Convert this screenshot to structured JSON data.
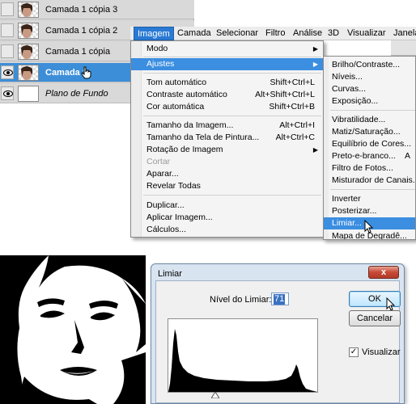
{
  "layers": [
    {
      "name": "Camada 1 cópia 3",
      "visible": false,
      "selected": false
    },
    {
      "name": "Camada 1 cópia 2",
      "visible": false,
      "selected": false
    },
    {
      "name": "Camada 1 cópia",
      "visible": false,
      "selected": false
    },
    {
      "name": "Camada 1",
      "visible": true,
      "selected": true
    },
    {
      "name": "Plano de Fundo",
      "visible": true,
      "selected": false
    }
  ],
  "menubar": [
    "Imagem",
    "Camada",
    "Selecionar",
    "Filtro",
    "Análise",
    "3D",
    "Visualizar",
    "Janela"
  ],
  "menu": [
    {
      "label": "Modo",
      "shortcut": "",
      "submenu": true
    },
    {
      "label": "Ajustes",
      "shortcut": "",
      "submenu": true,
      "highlighted": true
    },
    {
      "label": "Tom automático",
      "shortcut": "Shift+Ctrl+L"
    },
    {
      "label": "Contraste automático",
      "shortcut": "Alt+Shift+Ctrl+L"
    },
    {
      "label": "Cor automática",
      "shortcut": "Shift+Ctrl+B"
    },
    {
      "label": "Tamanho da Imagem...",
      "shortcut": "Alt+Ctrl+I"
    },
    {
      "label": "Tamanho da Tela de Pintura...",
      "shortcut": "Alt+Ctrl+C"
    },
    {
      "label": "Rotação de Imagem",
      "shortcut": "",
      "submenu": true
    },
    {
      "label": "Cortar",
      "shortcut": "",
      "disabled": true
    },
    {
      "label": "Aparar...",
      "shortcut": ""
    },
    {
      "label": "Revelar Todas",
      "shortcut": ""
    },
    {
      "label": "Duplicar...",
      "shortcut": ""
    },
    {
      "label": "Aplicar Imagem...",
      "shortcut": ""
    },
    {
      "label": "Cálculos...",
      "shortcut": ""
    }
  ],
  "submenu": [
    "Brilho/Contraste...",
    "Níveis...",
    "Curvas...",
    "Exposição...",
    "Vibratilidade...",
    "Matiz/Saturação...",
    "Equilíbrio de Cores...",
    "Preto-e-branco...",
    "Filtro de Fotos...",
    "Misturador de Canais...",
    "Inverter",
    "Posterizar...",
    "Limiar...",
    "Mapa de Degradê..."
  ],
  "submenu_cut": "A",
  "dialog": {
    "title": "Limiar",
    "close": "x",
    "level_label": "Nível do Limiar:",
    "level_value": "71",
    "ok": "OK",
    "cancel": "Cancelar",
    "preview_label": "Visualizar",
    "preview_checked": true
  },
  "colors": {
    "selection": "#3d8ed8",
    "menu_highlight": "#3b8ee0",
    "close_button": "#c74a36"
  }
}
